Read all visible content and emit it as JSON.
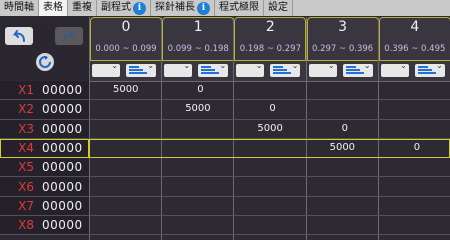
{
  "tabs": [
    {
      "label": "時間軸",
      "active": false,
      "info": false
    },
    {
      "label": "表格",
      "active": true,
      "info": false
    },
    {
      "label": "重複",
      "active": false,
      "info": false
    },
    {
      "label": "副程式",
      "active": false,
      "info": true
    },
    {
      "label": "探針補長",
      "active": false,
      "info": true
    },
    {
      "label": "程式極限",
      "active": false,
      "info": false
    },
    {
      "label": "設定",
      "active": false,
      "info": false
    }
  ],
  "info_glyph": "i",
  "columns": [
    {
      "index": "0",
      "range": "0.000 ~ 0.099"
    },
    {
      "index": "1",
      "range": "0.099 ~ 0.198"
    },
    {
      "index": "2",
      "range": "0.198 ~ 0.297"
    },
    {
      "index": "3",
      "range": "0.297 ~ 0.396"
    },
    {
      "index": "4",
      "range": "0.396 ~ 0.495"
    }
  ],
  "rows": [
    {
      "label": "X1",
      "value": "00000",
      "cells": [
        "5000",
        "0",
        "",
        "",
        ""
      ]
    },
    {
      "label": "X2",
      "value": "00000",
      "cells": [
        "",
        "5000",
        "0",
        "",
        ""
      ]
    },
    {
      "label": "X3",
      "value": "00000",
      "cells": [
        "",
        "",
        "5000",
        "0",
        ""
      ]
    },
    {
      "label": "X4",
      "value": "00000",
      "cells": [
        "",
        "",
        "",
        "5000",
        "0"
      ],
      "selected": true
    },
    {
      "label": "X5",
      "value": "00000",
      "cells": [
        "",
        "",
        "",
        "",
        ""
      ]
    },
    {
      "label": "X6",
      "value": "00000",
      "cells": [
        "",
        "",
        "",
        "",
        ""
      ]
    },
    {
      "label": "X7",
      "value": "00000",
      "cells": [
        "",
        "",
        "",
        "",
        ""
      ]
    },
    {
      "label": "X8",
      "value": "00000",
      "cells": [
        "",
        "",
        "",
        "",
        ""
      ]
    }
  ],
  "colors": {
    "accent": "#1e7fd9",
    "row_label": "#e03a3a",
    "selection": "#d4cc2a"
  },
  "icons": {
    "undo": "undo-icon",
    "redo": "redo-icon",
    "reset": "reset-icon"
  }
}
